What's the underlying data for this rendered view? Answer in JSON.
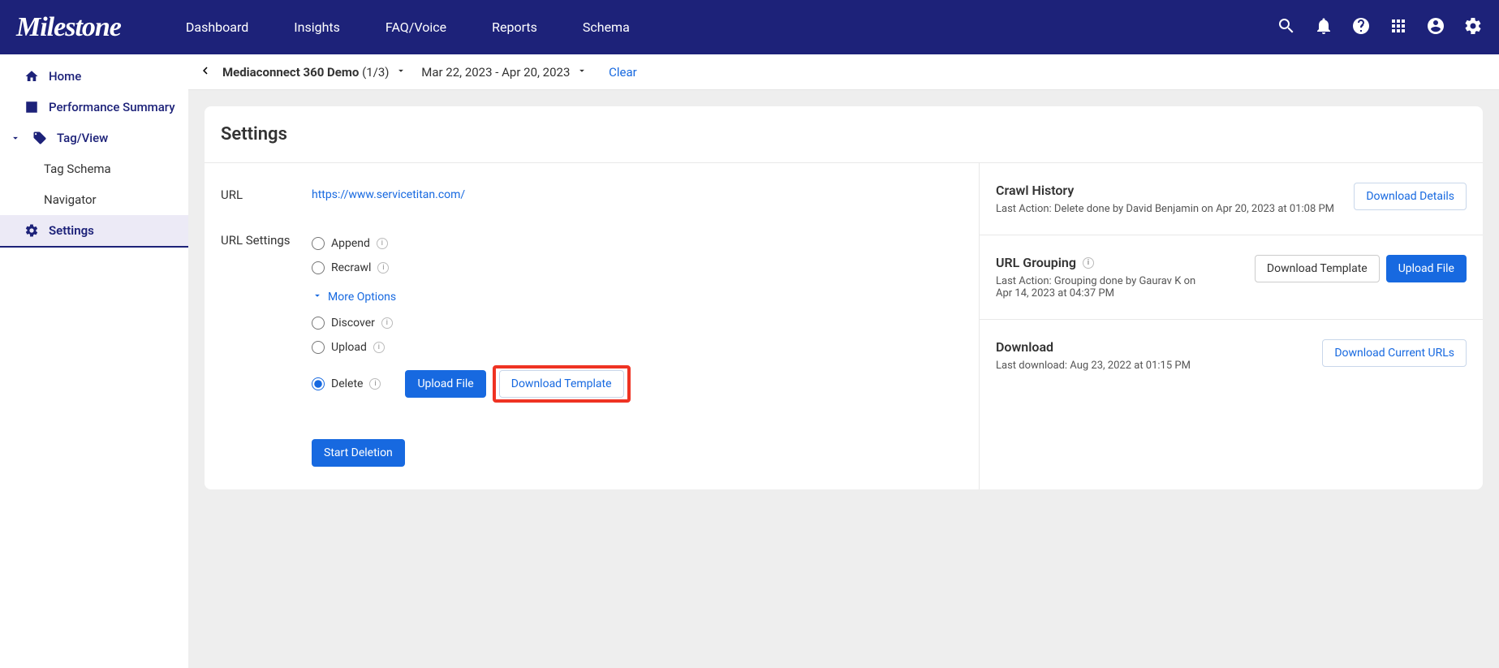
{
  "brand": "Milestone",
  "nav": {
    "dashboard": "Dashboard",
    "insights": "Insights",
    "faq": "FAQ/Voice",
    "reports": "Reports",
    "schema": "Schema"
  },
  "sidebar": {
    "home": "Home",
    "performance": "Performance Summary",
    "tagview": "Tag/View",
    "tagschema": "Tag Schema",
    "navigator": "Navigator",
    "settings": "Settings"
  },
  "subheader": {
    "account": "Mediaconnect 360 Demo",
    "count": "(1/3)",
    "daterange": "Mar 22, 2023 - Apr 20, 2023",
    "clear": "Clear"
  },
  "settings_title": "Settings",
  "left": {
    "url_label": "URL",
    "url_value": "https://www.servicetitan.com/",
    "url_settings_label": "URL Settings",
    "opt_append": "Append",
    "opt_recrawl": "Recrawl",
    "more_options": "More Options",
    "opt_discover": "Discover",
    "opt_upload": "Upload",
    "opt_delete": "Delete",
    "btn_upload": "Upload File",
    "btn_dl_tpl": "Download Template",
    "btn_start": "Start Deletion"
  },
  "right": {
    "crawl_title": "Crawl History",
    "crawl_sub": "Last Action: Delete done by David Benjamin on Apr 20, 2023 at 01:08 PM",
    "btn_dl_details": "Download Details",
    "group_title": "URL Grouping",
    "group_sub": "Last Action: Grouping done by Gaurav K on Apr 14, 2023 at 04:37 PM",
    "btn_dl_template": "Download Template",
    "btn_upload_file": "Upload File",
    "download_title": "Download",
    "download_sub": "Last download: Aug 23, 2022 at 01:15 PM",
    "btn_dl_current": "Download Current URLs"
  }
}
